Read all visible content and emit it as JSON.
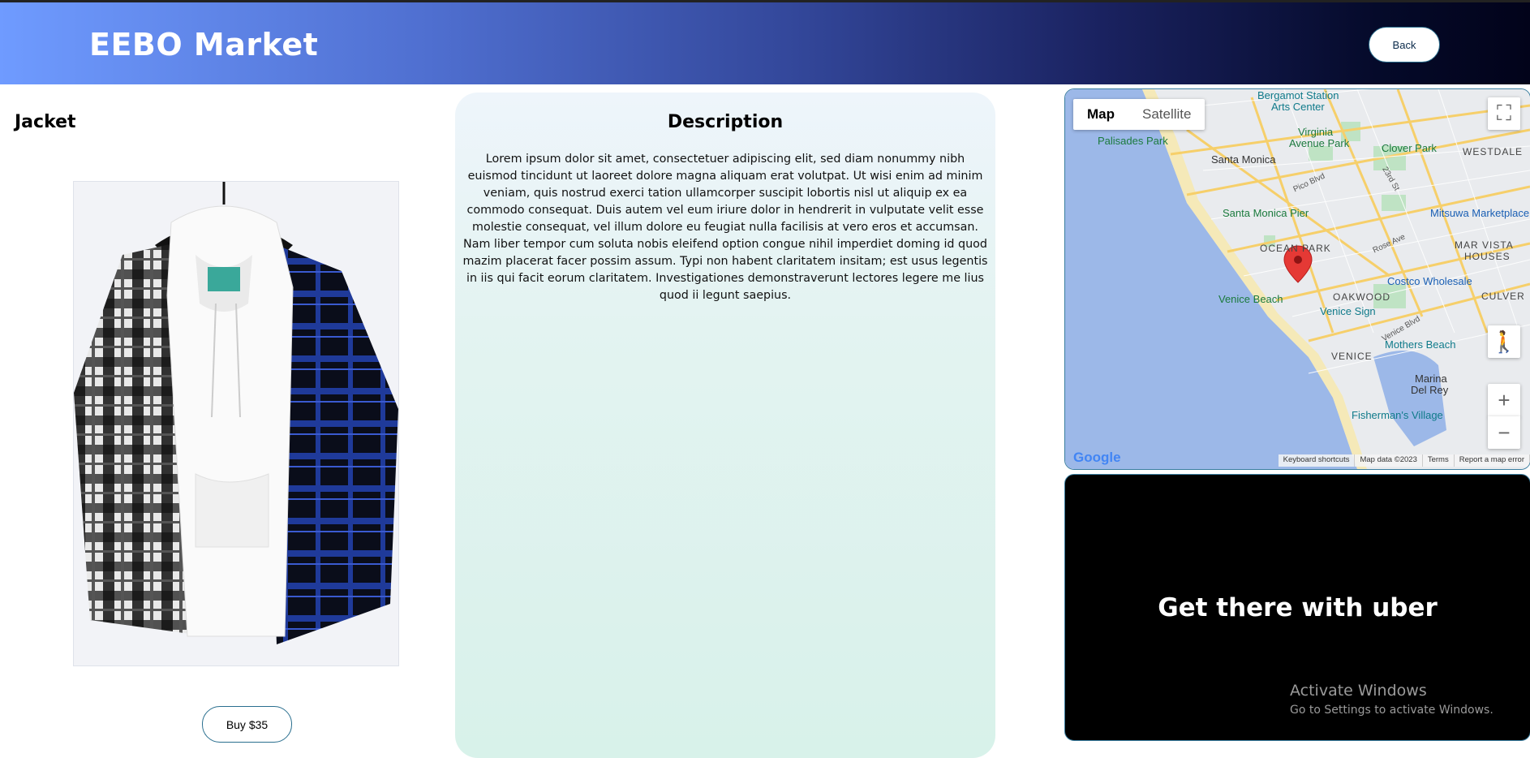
{
  "header": {
    "brand": "EEBO Market",
    "back_label": "Back"
  },
  "product": {
    "title": "Jacket",
    "image_alt": "plaid-shirt-hoodie-jacket",
    "buy_label": "Buy $35"
  },
  "description": {
    "title": "Description",
    "body": "Lorem ipsum dolor sit amet, consectetuer adipiscing elit, sed diam nonummy nibh euismod tincidunt ut laoreet dolore magna aliquam erat volutpat. Ut wisi enim ad minim veniam, quis nostrud exerci tation ullamcorper suscipit lobortis nisl ut aliquip ex ea commodo consequat. Duis autem vel eum iriure dolor in hendrerit in vulputate velit esse molestie consequat, vel illum dolore eu feugiat nulla facilisis at vero eros et accumsan. Nam liber tempor cum soluta nobis eleifend option congue nihil imperdiet doming id quod mazim placerat facer possim assum. Typi non habent claritatem insitam; est usus legentis in iis qui facit eorum claritatem. Investigationes demonstraverunt lectores legere me lius quod ii legunt saepius."
  },
  "map": {
    "map_tab": "Map",
    "satellite_tab": "Satellite",
    "google": "Google",
    "footer": {
      "shortcuts": "Keyboard shortcuts",
      "data": "Map data ©2023",
      "terms": "Terms",
      "report": "Report a map error"
    },
    "labels": {
      "bergamot": "Bergamot Station",
      "arts_center": "Arts Center",
      "palisades": "Palisades Park",
      "santa_monica": "Santa Monica",
      "virginia1": "Virginia",
      "virginia2": "Avenue Park",
      "clover": "Clover Park",
      "westdale": "WESTDALE",
      "pier": "Santa Monica Pier",
      "mitsuwa": "Mitsuwa Marketplace",
      "ocean_park": "OCEAN PARK",
      "mar_vista1": "MAR VISTA",
      "mar_vista2": "HOUSES",
      "costco": "Costco Wholesale",
      "venice_beach": "Venice Beach",
      "oakwood": "OAKWOOD",
      "culver": "CULVER",
      "venice_sign": "Venice Sign",
      "venice": "VENICE",
      "mothers": "Mothers Beach",
      "marina1": "Marina",
      "marina2": "Del Rey",
      "fisherman": "Fisherman's Village",
      "pico": "Pico Blvd",
      "st23": "23rd St",
      "rose": "Rose Ave",
      "venice_blvd": "Venice Blvd"
    }
  },
  "uber": {
    "text": "Get there with uber"
  },
  "windows": {
    "title": "Activate Windows",
    "subtitle": "Go to Settings to activate Windows."
  },
  "colors": {
    "header_start": "#6f9bff",
    "header_end": "#02031a",
    "accent_border": "#2a6f8f",
    "panel_top": "#eef5fb",
    "panel_bottom": "#d8f2ea"
  }
}
